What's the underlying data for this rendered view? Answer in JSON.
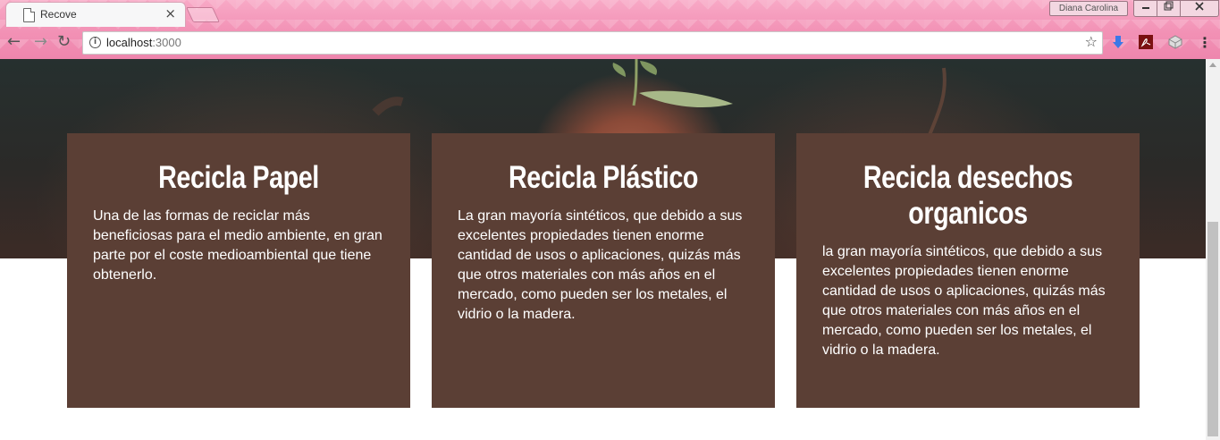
{
  "browser": {
    "tab_title": "Recove",
    "tab_close": "×",
    "profile_name": "Diana Carolina",
    "url_host": "localhost",
    "url_port": ":3000"
  },
  "cards": [
    {
      "title": "Recicla Papel",
      "text": "Una de las formas de reciclar más beneficiosas para el medio ambiente, en gran parte por el coste medioambiental que tiene obtenerlo."
    },
    {
      "title": "Recicla Plástico",
      "text": "La gran mayoría sintéticos, que debido a sus excelentes propiedades tienen enorme cantidad de usos o aplicaciones, quizás más que otros materiales con más años en el mercado, como pueden ser los metales, el vidrio o la madera."
    },
    {
      "title": "Recicla desechos organicos",
      "text": "la gran mayoría sintéticos, que debido a sus excelentes propiedades tienen enorme cantidad de usos o aplicaciones, quizás más que otros materiales con más años en el mercado, como pueden ser los metales, el vidrio o la madera."
    }
  ],
  "colors": {
    "card_bg": "#5b3f35",
    "chrome_pink": "#f291b5"
  }
}
